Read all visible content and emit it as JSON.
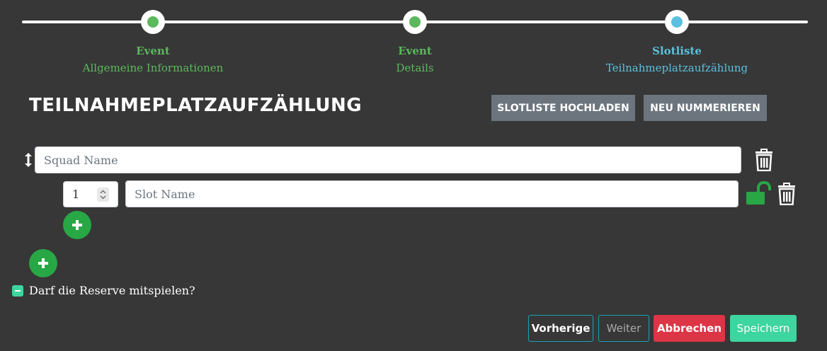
{
  "stepper": {
    "steps": [
      {
        "title": "Event",
        "subtitle": "Allgemeine Informationen",
        "color": "#5cb85c"
      },
      {
        "title": "Event",
        "subtitle": "Details",
        "color": "#5cb85c"
      },
      {
        "title": "Slotliste",
        "subtitle": "Teilnahmeplatzaufzählung",
        "color": "#5bc0de"
      }
    ]
  },
  "page": {
    "title": "TEILNAHMEPLATZAUFZÄHLUNG",
    "upload_button": "SLOTLISTE HOCHLADEN",
    "renumber_button": "NEU NUMMERIEREN"
  },
  "squad": {
    "name_placeholder": "Squad Name",
    "slot": {
      "number": "1",
      "name_placeholder": "Slot Name"
    }
  },
  "reserve": {
    "label": "Darf die Reserve mitspielen?"
  },
  "footer": {
    "previous": "Vorherige",
    "next": "Weiter",
    "cancel": "Abbrechen",
    "save": "Speichern"
  },
  "colors": {
    "background": "#373737",
    "success": "#28a745",
    "danger": "#dc3545",
    "teal": "#3dd5a0",
    "secondary": "#6c757d"
  }
}
